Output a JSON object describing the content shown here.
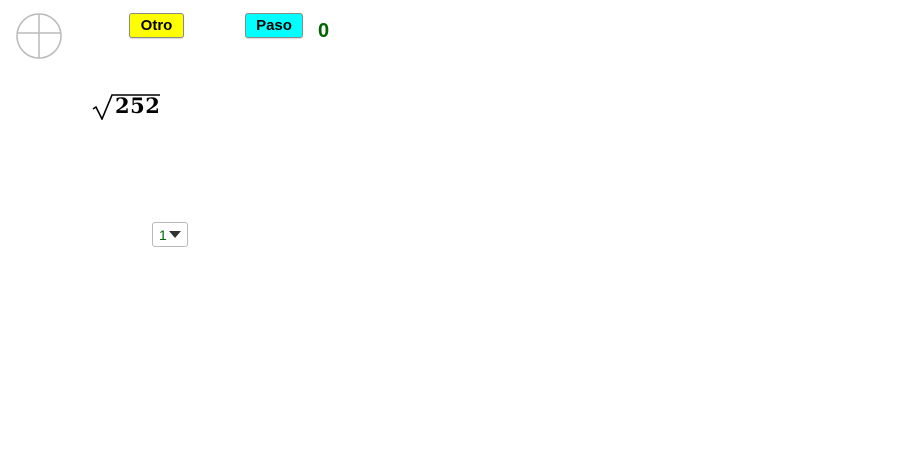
{
  "toolbar": {
    "reset_icon": "circle-cross-icon",
    "otro_label": "Otro",
    "paso_label": "Paso",
    "counter_value": "0"
  },
  "expression": {
    "radical_symbol": "√",
    "radicand": "252"
  },
  "selector": {
    "selected_value": "1",
    "arrow_icon": "triangle-down-icon"
  },
  "colors": {
    "otro_button": "#ffff00",
    "paso_button": "#00ffff",
    "counter_text": "#006400",
    "selector_text": "#006400"
  }
}
